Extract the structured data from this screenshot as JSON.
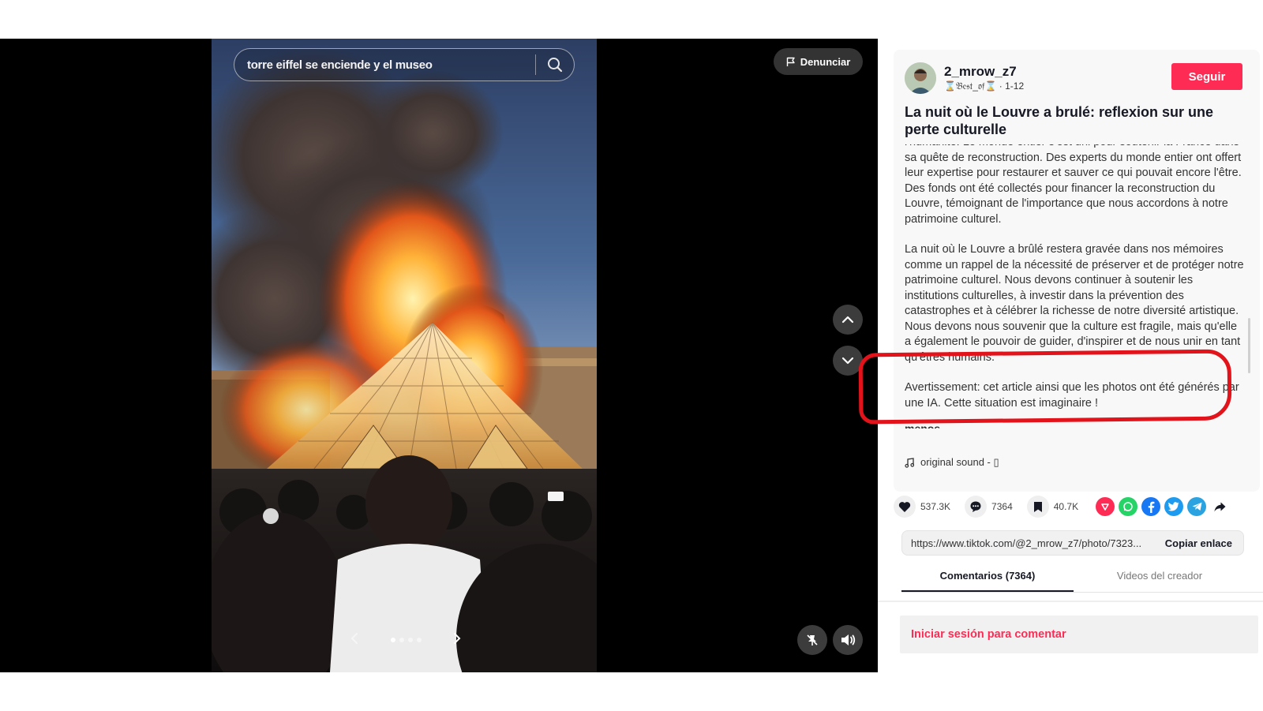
{
  "video": {
    "search_query": "torre eiffel se enciende y el museo",
    "report_label": "Denunciar",
    "slides_total": 4,
    "slide_active": 1
  },
  "post": {
    "username": "2_mrow_z7",
    "submeta": "⌛𝔅𝔢𝔰𝔱_𝔬𝔣⌛ · 1-12",
    "follow_label": "Seguir",
    "title": "La nuit où le Louvre a brulé: reflexion sur une perte culturelle",
    "desc_paragraph_1": "l'humanité. Le monde entier s'est uni pour soutenir la France dans sa quête de reconstruction. Des experts du monde entier ont offert leur expertise pour restaurer et sauver ce qui pouvait encore l'être. Des fonds ont été collectés pour financer la reconstruction du Louvre, témoignant de l'importance que nous accordons à notre patrimoine culturel.",
    "desc_paragraph_2": "La nuit où le Louvre a brûlé restera gravée dans nos mémoires comme un rappel de la nécessité de préserver et de protéger notre patrimoine culturel. Nous devons continuer à soutenir les institutions culturelles, à investir dans la prévention des catastrophes et à célébrer la richesse de notre diversité artistique. Nous devons nous souvenir que la culture est fragile, mais qu'elle a également le pouvoir de guider, d'inspirer et de nous unir en tant qu'êtres humains.",
    "warning": "Avertissement: cet article ainsi que les photos ont été générés par une IA. Cette situation est imaginaire !",
    "less_label": "menos",
    "sound_label": "original sound - ▯"
  },
  "actions": {
    "likes": "537.3K",
    "comments": "7364",
    "saves": "40.7K"
  },
  "share": {
    "url": "https://www.tiktok.com/@2_mrow_z7/photo/7323...",
    "copy_label": "Copiar enlace"
  },
  "tabs": {
    "comments": "Comentarios (7364)",
    "creator_videos": "Videos del creador"
  },
  "comments": {
    "login_prompt": "Iniciar sesión para comentar"
  },
  "colors": {
    "brand": "#fe2c55",
    "highlight": "#e3131b",
    "whatsapp": "#25d366",
    "facebook": "#1877f2",
    "twitter": "#1d9bf0",
    "telegram": "#2aa3e0"
  }
}
